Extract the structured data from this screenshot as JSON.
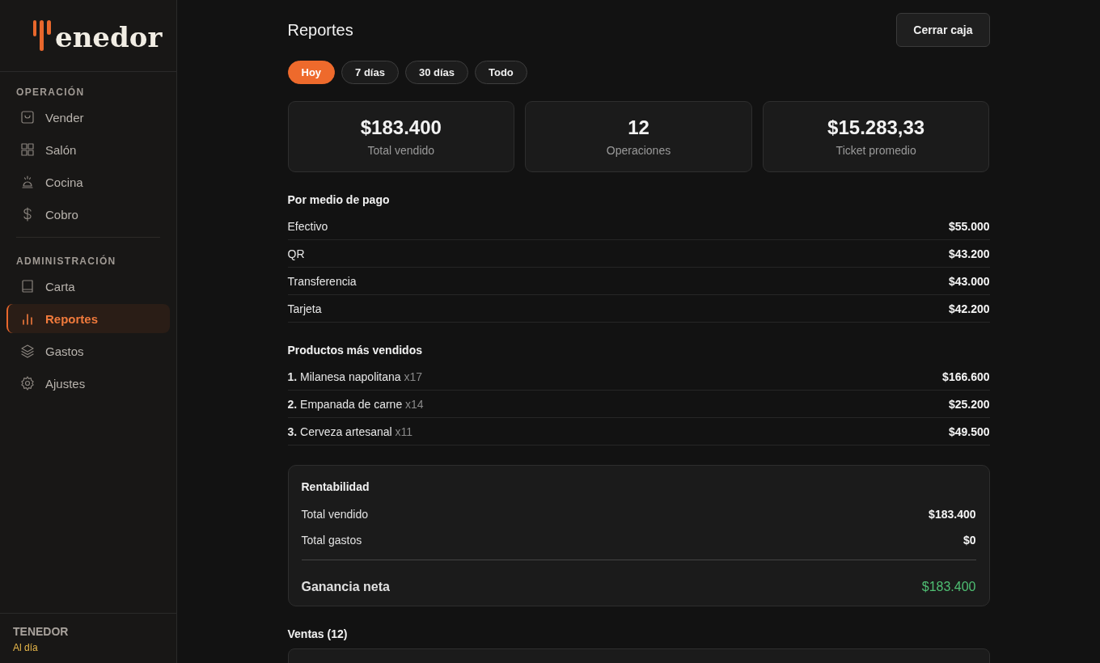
{
  "sidebar": {
    "logo": "enedor",
    "sections": [
      {
        "title": "OPERACIÓN",
        "items": [
          {
            "label": "Vender",
            "selected": false
          },
          {
            "label": "Salón",
            "selected": false
          },
          {
            "label": "Cocina",
            "selected": false
          },
          {
            "label": "Cobro",
            "selected": false
          }
        ]
      },
      {
        "title": "ADMINISTRACIÓN",
        "items": [
          {
            "label": "Carta",
            "selected": false
          },
          {
            "label": "Reportes",
            "selected": true
          },
          {
            "label": "Gastos",
            "selected": false
          },
          {
            "label": "Ajustes",
            "selected": false
          }
        ]
      }
    ],
    "footer": {
      "name": "TENEDOR",
      "status": "Al día"
    }
  },
  "header": {
    "title": "Reportes",
    "button": "Cerrar caja"
  },
  "periods": [
    {
      "label": "Hoy",
      "selected": true
    },
    {
      "label": "7 días",
      "selected": false
    },
    {
      "label": "30 días",
      "selected": false
    },
    {
      "label": "Todo",
      "selected": false
    }
  ],
  "stats": [
    {
      "value": "$183.400",
      "label": "Total vendido"
    },
    {
      "value": "12",
      "label": "Operaciones"
    },
    {
      "value": "$15.283,33",
      "label": "Ticket promedio"
    }
  ],
  "payments": {
    "title": "Por medio de pago",
    "rows": [
      {
        "label": "Efectivo",
        "amount": "$55.000"
      },
      {
        "label": "QR",
        "amount": "$43.200"
      },
      {
        "label": "Transferencia",
        "amount": "$43.000"
      },
      {
        "label": "Tarjeta",
        "amount": "$42.200"
      }
    ]
  },
  "products": {
    "title": "Productos más vendidos",
    "rows": [
      {
        "rank": "1.",
        "name": "Milanesa napolitana",
        "qty": "x17",
        "amount": "$166.600"
      },
      {
        "rank": "2.",
        "name": "Empanada de carne",
        "qty": "x14",
        "amount": "$25.200"
      },
      {
        "rank": "3.",
        "name": "Cerveza artesanal",
        "qty": "x11",
        "amount": "$49.500"
      }
    ]
  },
  "profit": {
    "title": "Rentabilidad",
    "rows": [
      {
        "kind": "line",
        "label": "Total vendido",
        "amount": "$183.400"
      },
      {
        "kind": "line",
        "label": "Total gastos",
        "amount": "$0"
      },
      {
        "kind": "net",
        "label": "Ganancia neta",
        "amount": "$183.400"
      }
    ]
  },
  "sales": {
    "title": "Ventas (12)"
  }
}
